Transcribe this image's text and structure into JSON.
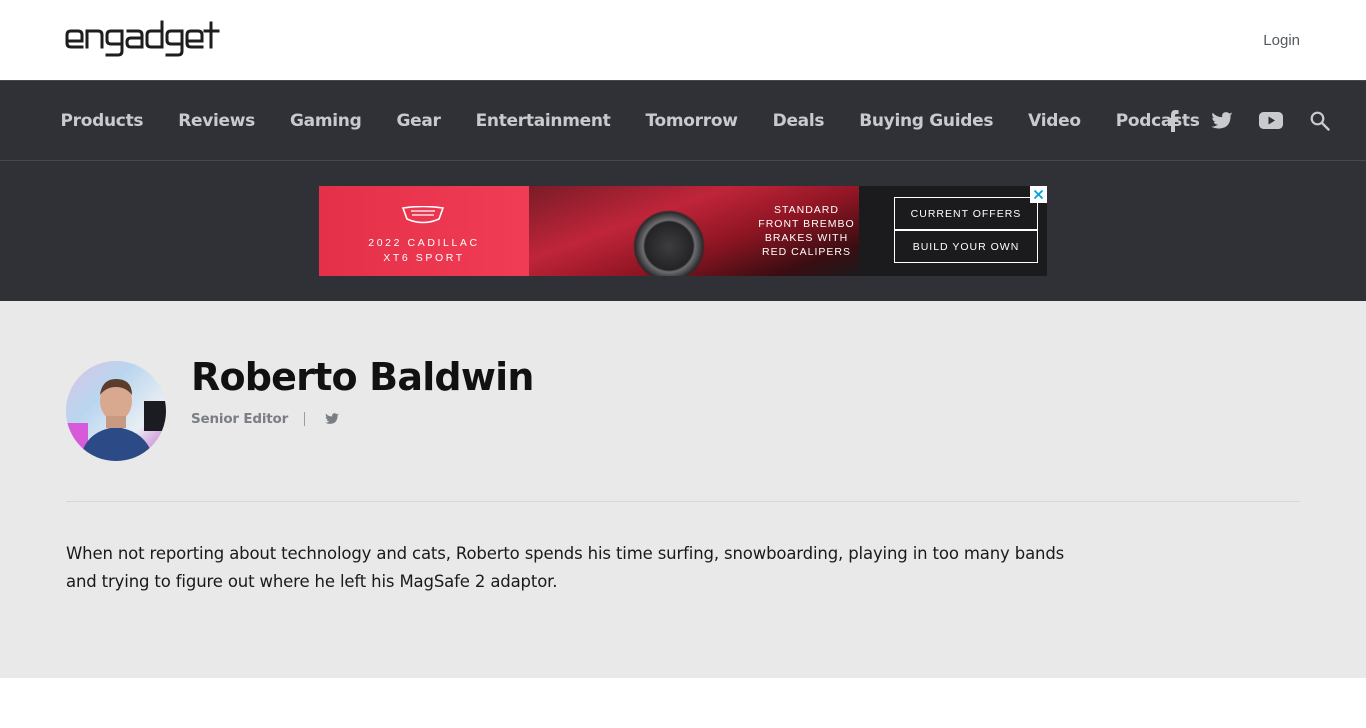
{
  "header": {
    "logo_text": "engadget",
    "login_label": "Login"
  },
  "nav": {
    "items": [
      {
        "label": "Products"
      },
      {
        "label": "Reviews"
      },
      {
        "label": "Gaming"
      },
      {
        "label": "Gear"
      },
      {
        "label": "Entertainment"
      },
      {
        "label": "Tomorrow"
      },
      {
        "label": "Deals"
      },
      {
        "label": "Buying Guides"
      },
      {
        "label": "Video"
      },
      {
        "label": "Podcasts"
      }
    ],
    "icons": [
      "facebook-icon",
      "twitter-icon",
      "youtube-icon",
      "search-icon"
    ],
    "icon_color": "#c8cacd",
    "background": "#2f3136"
  },
  "ad": {
    "model_line1": "2022 CADILLAC",
    "model_line2": "XT6 SPORT",
    "copy_line1": "STANDARD",
    "copy_line2": "FRONT BREMBO",
    "copy_line3": "BRAKES WITH",
    "copy_line4": "RED CALIPERS",
    "button1": "CURRENT OFFERS",
    "button2": "BUILD YOUR OWN",
    "accent": "#e53049"
  },
  "author": {
    "name": "Roberto Baldwin",
    "role": "Senior Editor",
    "bio": "When not reporting about technology and cats, Roberto spends his time surfing, snowboarding, playing in too many bands and trying to figure out where he left his MagSafe 2 adaptor.",
    "background": "#e9e9e9"
  }
}
